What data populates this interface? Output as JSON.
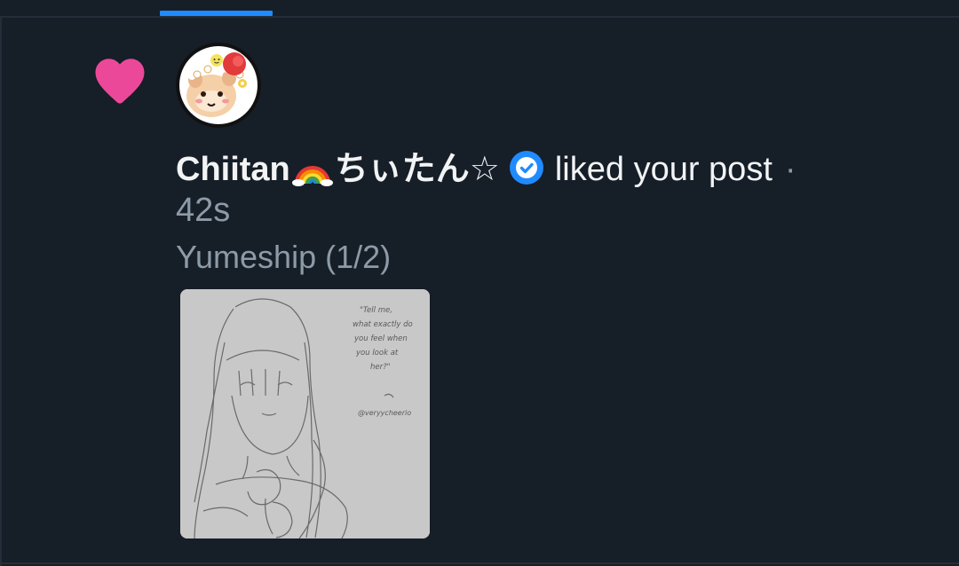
{
  "notification": {
    "author_name": "Chiitan",
    "author_name_suffix": "ちぃたん☆",
    "action": "liked your post",
    "separator": "·",
    "timestamp": "42s",
    "post_title": "Yumeship (1/2)",
    "image_caption_lines": [
      "\"Tell me,",
      "what exactly do",
      "you feel when",
      "you look at",
      "her?\""
    ],
    "image_signature": "@veryycheerio"
  },
  "icons": {
    "like": "heart-icon",
    "verified": "verified-check-icon",
    "emoji": "rainbow-icon"
  },
  "colors": {
    "background": "#161e27",
    "accent": "#208bfe",
    "heart": "#ec4899",
    "text_primary": "#f1f3f5",
    "text_secondary": "#8d9aa8"
  }
}
